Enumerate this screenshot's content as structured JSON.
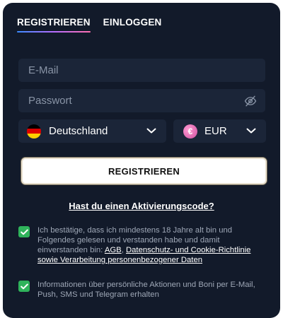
{
  "tabs": [
    {
      "label": "REGISTRIEREN",
      "active": true
    },
    {
      "label": "EINLOGGEN",
      "active": false
    }
  ],
  "form": {
    "email_placeholder": "E-Mail",
    "password_placeholder": "Passwort",
    "country": "Deutschland",
    "currency": "EUR",
    "currency_symbol": "€",
    "submit_label": "REGISTRIEREN"
  },
  "activation_link": "Hast du einen Aktivierungscode?",
  "consents": [
    {
      "checked": true,
      "text_before": "Ich bestätige, dass ich mindestens 18 Jahre alt bin und Folgendes gelesen und verstanden habe und damit einverstanden bin: ",
      "link1": "AGB",
      "separator": ",",
      "link2": "Datenschutz- und Cookie-Richtlinie sowie Verarbeitung personenbezogener Daten"
    },
    {
      "checked": true,
      "text": "Informationen über persönliche Aktionen und Boni per E-Mail, Push, SMS und Telegram erhalten"
    }
  ],
  "colors": {
    "panel": "#121a2a",
    "field": "#1b2538",
    "checkbox": "#2fb35b",
    "flag_de": [
      "#000000",
      "#dd0000",
      "#ffce00"
    ]
  },
  "icons": {
    "password_toggle": "eye-slash-icon",
    "country_flag": "germany-flag-icon",
    "currency": "euro-icon",
    "dropdown": "chevron-down-icon",
    "checkbox": "check-icon"
  }
}
